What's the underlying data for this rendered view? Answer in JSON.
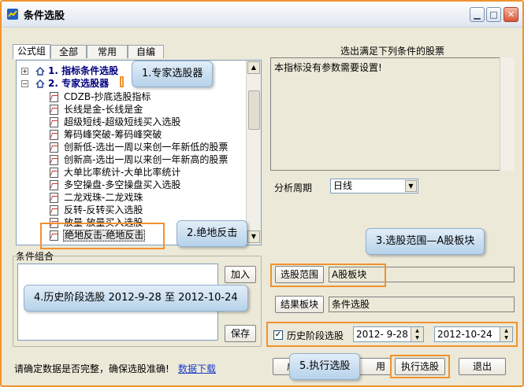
{
  "window": {
    "title": "条件选股"
  },
  "tabs": [
    "公式组",
    "全部",
    "常用",
    "自编"
  ],
  "tree": {
    "groups": [
      "1. 指标条件选股",
      "2. 专家选股器"
    ],
    "items": [
      "CDZB-抄底选股指标",
      "长线是金-长线是金",
      "超级短线-超级短线买入选股",
      "筹码峰突破-筹码峰突破",
      "创新低-选出一周以来创一年新低的股票",
      "创新高-选出一周以来创一年新高的股票",
      "大单比率统计-大单比率统计",
      "多空操盘-多空操盘买入选股",
      "二龙戏珠-二龙戏珠",
      "反转-反转买入选股",
      "放量-放量买入选股",
      "绝地反击-绝地反击"
    ]
  },
  "right_panel": {
    "title": "选出满足下列条件的股票",
    "description": "本指标没有参数需要设置!",
    "period_label": "分析周期",
    "period_value": "日线"
  },
  "conditions": {
    "group_label": "条件组合",
    "add_button": "加入",
    "save_button": "保存"
  },
  "range": {
    "button": "选股范围",
    "value": "A股板块"
  },
  "result": {
    "button": "结果板块",
    "value": "条件选股"
  },
  "history": {
    "checkbox_label": "历史阶段选股",
    "checked": true,
    "start_date": "2012- 9-28",
    "end_date": "2012-10-24"
  },
  "footer": {
    "notice": "请确定数据是否完整，确保选股准确!",
    "download_link": "数据下载",
    "partial_left": "成",
    "partial_right": "用",
    "execute_button": "执行选股",
    "exit_button": "退出"
  },
  "callouts": {
    "c1": "1.专家选股器",
    "c2": "2.绝地反击",
    "c3": "3.选股范围—A股板块",
    "c4": "4.历史阶段选股 2012-9-28 至 2012-10-24",
    "c5": "5.执行选股"
  },
  "colors": {
    "highlight": "#f0922e",
    "group_text": "#00007f",
    "link": "#1a3ccc"
  }
}
